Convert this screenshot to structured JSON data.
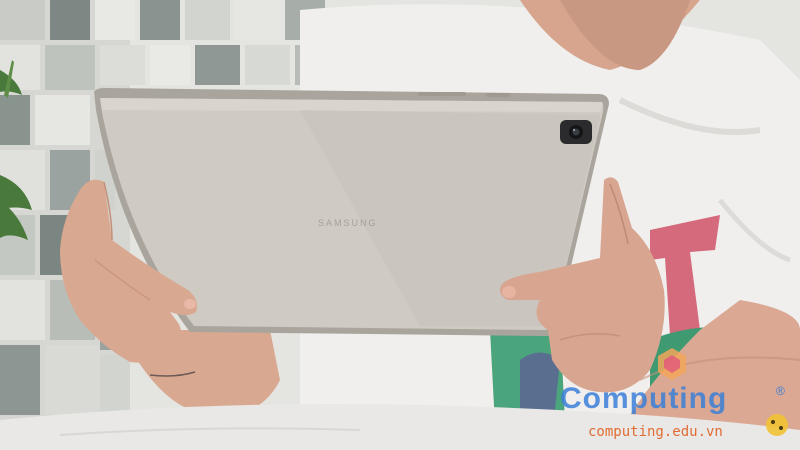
{
  "scene": {
    "description_free": true,
    "colors": {
      "wall": "#d8d9d5",
      "wall_tile_dark": "#7f8a86",
      "shirt": "#f1f0ee",
      "tablet_body": "#cfcac2",
      "tablet_edge": "#aaa59c",
      "camera": "#2b2b2d",
      "skin": "#d9a891",
      "skin_shadow": "#b98570",
      "table": "#e9e8e6",
      "shirt_print_pink": "#d46a7c",
      "shirt_print_green": "#3f9a72",
      "plant": "#4a7a3b"
    },
    "icons": [
      "camera-lens-icon",
      "watermark-logo-icon",
      "registered-mark-icon"
    ]
  },
  "tablet": {
    "brand": "SAMSUNG"
  },
  "watermark": {
    "name": "Computing",
    "url": "computing.edu.vn",
    "registered": "®",
    "colors": {
      "text": "#3c7fd8",
      "url": "#e06020",
      "badge": "#f1c232"
    }
  }
}
